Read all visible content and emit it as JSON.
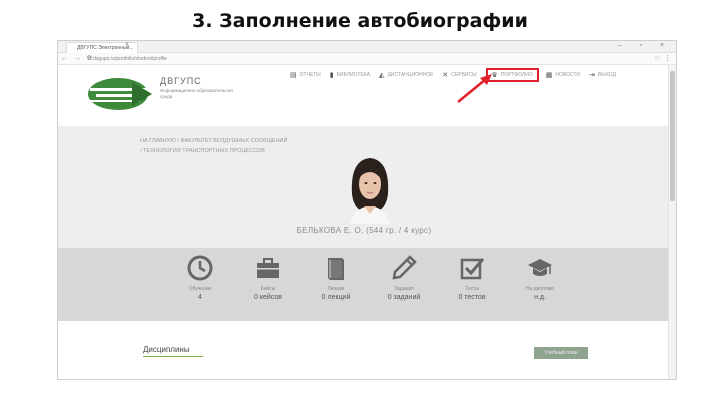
{
  "slide": {
    "title": "3. Заполнение автобиографии"
  },
  "browser": {
    "tab_label": "ДВГУПС Электронный...",
    "url": "lk.dvgups.ru/portfolio/student/profile",
    "window_controls": "– ▫ ×"
  },
  "site": {
    "logo_title": "ДВГУПС",
    "logo_subtitle": "Информационно-образовательная среда",
    "nav": [
      {
        "label": "ОТЧЕТЫ",
        "icon": "report-icon"
      },
      {
        "label": "БИБЛИОТЕКА",
        "icon": "book-icon"
      },
      {
        "label": "ДИСТАНЦИОННОЕ",
        "icon": "graduation-icon"
      },
      {
        "label": "СЕРВИСЫ",
        "icon": "tools-icon"
      },
      {
        "label": "ПОРТФОЛИО",
        "icon": "trophy-icon",
        "highlighted": true
      },
      {
        "label": "НОВОСТИ",
        "icon": "news-icon"
      },
      {
        "label": "ВЫХОД",
        "icon": "logout-icon"
      }
    ]
  },
  "profile": {
    "breadcrumb_1": "НА ГЛАВНУЮ / ФАКУЛЬТЕТ ВОЗДУШНЫХ СООБЩЕНИЙ",
    "breadcrumb_2": "/ ТЕХНОЛОГИЯ ТРАНСПОРТНЫХ ПРОЦЕССОВ",
    "name": "БЕЛЬКОВА Е. О. (544 гр. / 4 курс)"
  },
  "stats": [
    {
      "label": "Обучение",
      "value": "4",
      "icon": "clock-icon"
    },
    {
      "label": "Кейсы",
      "value": "0 кейсов",
      "icon": "briefcase-icon"
    },
    {
      "label": "Лекции",
      "value": "0 лекций",
      "icon": "book-icon"
    },
    {
      "label": "Задания",
      "value": "0 заданий",
      "icon": "pencil-icon"
    },
    {
      "label": "Тесты",
      "value": "0 тестов",
      "icon": "checkbox-icon"
    },
    {
      "label": "На дипломе",
      "value": "н.д.",
      "icon": "graduation-cap-icon"
    }
  ],
  "disciplines": {
    "title": "Дисциплины",
    "button": "Учебный план"
  },
  "colors": {
    "highlight": "#e0202b",
    "accent_green": "#7ab24e",
    "logo_green": "#3c8a3a"
  }
}
